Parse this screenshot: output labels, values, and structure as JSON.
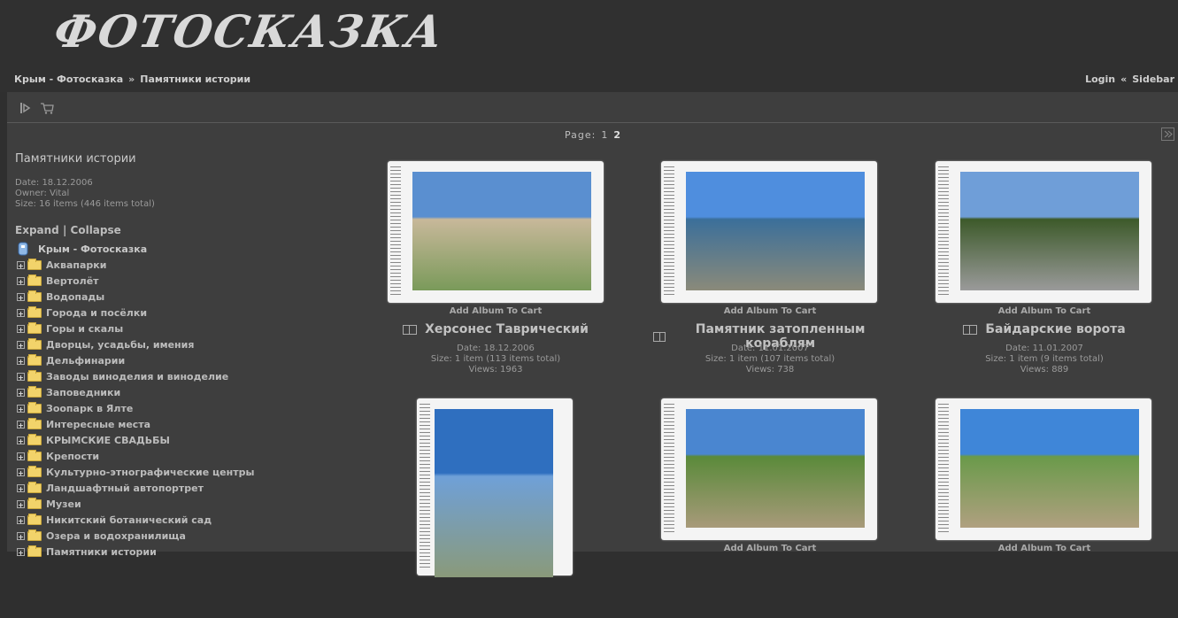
{
  "header": {
    "logo_text": "ФОТОСКАЗКА",
    "breadcrumb": [
      "Крым - Фотосказка",
      "Памятники истории"
    ],
    "breadcrumb_sep": "»",
    "login": "Login",
    "link_sep": "«",
    "sidebar": "Sidebar"
  },
  "toolbar": {
    "icons": [
      "slideshow-icon",
      "cart-icon"
    ]
  },
  "pager": {
    "label": "Page:",
    "pages": [
      "1",
      "2"
    ],
    "current": "2"
  },
  "album": {
    "title": "Памятники истории",
    "date": "Date: 18.12.2006",
    "owner": "Owner: Vital",
    "size": "Size: 16 items (446 items total)"
  },
  "tree": {
    "expand": "Expand",
    "sep": "|",
    "collapse": "Collapse",
    "root": "Крым - Фотосказка",
    "items": [
      "Аквапарки",
      "Вертолёт",
      "Водопады",
      "Города и посёлки",
      "Горы и скалы",
      "Дворцы, усадьбы, имения",
      "Дельфинарии",
      "Заводы виноделия и виноделие",
      "Заповедники",
      "Зоопарк в Ялте",
      "Интересные места",
      "КРЫМСКИЕ СВАДЬБЫ",
      "Крепости",
      "Культурно-этнографические центры",
      "Ландшафтный автопортрет",
      "Музеи",
      "Никитский ботанический сад",
      "Озера и водохранилища",
      "Памятники истории"
    ]
  },
  "albums": [
    {
      "cart": "Add Album To Cart",
      "title": "Херсонес Таврический",
      "date": "Date: 18.12.2006",
      "size": "Size: 1 item (113 items total)",
      "views": "Views: 1963",
      "colors": [
        "#5a8fd0",
        "#c8b89a",
        "#7a9a5a"
      ]
    },
    {
      "cart": "Add Album To Cart",
      "title": "Памятник затопленным кораблям",
      "date": "Date: 11.01.2007",
      "size": "Size: 1 item (107 items total)",
      "views": "Views: 738",
      "colors": [
        "#4f8ede",
        "#3b6f9a",
        "#8a8a7a"
      ]
    },
    {
      "cart": "Add Album To Cart",
      "title": "Байдарские ворота",
      "date": "Date: 11.01.2007",
      "size": "Size: 1 item (9 items total)",
      "views": "Views: 889",
      "colors": [
        "#6f9ed8",
        "#3d5a2a",
        "#9a9a9a"
      ]
    },
    {
      "cart": "",
      "colors": [
        "#2f6fbf",
        "#6fa0d8",
        "#8a9a7a"
      ]
    },
    {
      "cart": "Add Album To Cart",
      "colors": [
        "#4a86d0",
        "#5a8a3a",
        "#a89a7a"
      ]
    },
    {
      "cart": "Add Album To Cart",
      "colors": [
        "#3f86d8",
        "#6a9a4a",
        "#b0a080"
      ]
    }
  ]
}
